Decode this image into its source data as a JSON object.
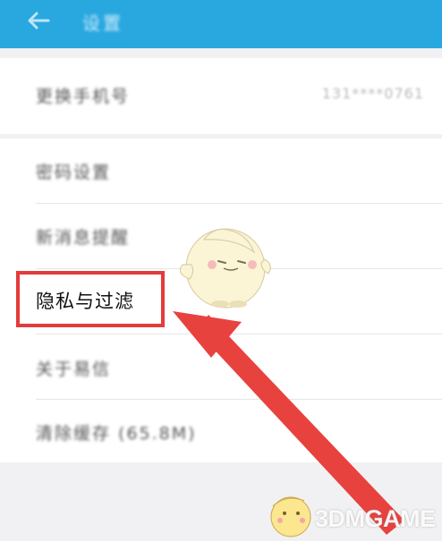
{
  "header": {
    "title": "设置"
  },
  "groups": [
    {
      "items": [
        {
          "label": "更换手机号",
          "value": "131****0761"
        }
      ]
    },
    {
      "items": [
        {
          "label": "密码设置"
        },
        {
          "label": "新消息提醒"
        },
        {
          "label": "隐私与过滤"
        },
        {
          "label": "关于易信"
        },
        {
          "label": "清除缓存 (65.8M)"
        }
      ]
    }
  ],
  "annotation": {
    "highlight_color": "#e43b3b",
    "highlighted_item": "隐私与过滤"
  },
  "colors": {
    "appbar": "#29a8e0",
    "background": "#f1f1f3"
  },
  "icons": {
    "back": "arrow-left-icon"
  },
  "watermark": {
    "text": "3DMGAME"
  }
}
